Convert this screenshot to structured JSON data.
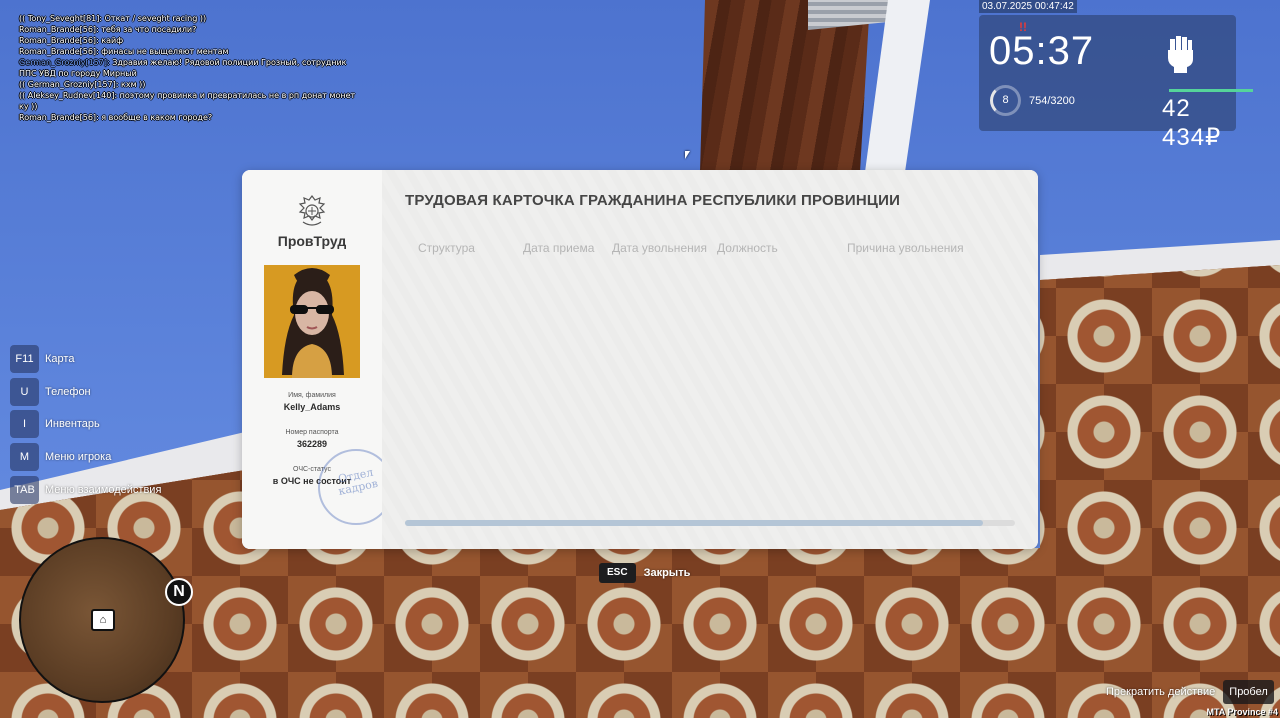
{
  "chat": [
    {
      "text": "(( Tony_Seveght[81]: Откат / seveght racing ))",
      "color": "#ffffff"
    },
    {
      "text": "Roman_Brande[56]: тебя за что посадили?",
      "color": "#ffffff"
    },
    {
      "text": "Roman_Brande[56]: кайф",
      "color": "#ffffff"
    },
    {
      "text": "Roman_Brande[56]: финасы не выщеляют ментам",
      "color": "#ffffff"
    },
    {
      "text_blue": "German_Grozniy[157]:",
      "text": " Здравия желаю! Рядовой полиции Грозный, сотрудник ППС УВД по городу Мирный",
      "color": "#6f9cf5"
    },
    {
      "text": "(( German_Grozniy[157]: кхм ))",
      "color": "#ffffff"
    },
    {
      "text": "(( Aleksey_Rudnev[140]: поэтому провинка и превратилась не в рп донат монет ку ))",
      "color": "#ffffff"
    },
    {
      "text": "Roman_Brande[56]: я вообще в каком городе?",
      "color": "#ffffff"
    }
  ],
  "hud": {
    "datetime": "03.07.2025 00:47:42",
    "clock": "05:37",
    "notification_mark": "!!",
    "level": "8",
    "xp": "754/3200",
    "xp_fraction": 0.236,
    "money": "42 434₽",
    "accent": "#55d49a"
  },
  "keys": [
    {
      "key": "F11",
      "label": "Карта"
    },
    {
      "key": "U",
      "label": "Телефон"
    },
    {
      "key": "I",
      "label": "Инвентарь"
    },
    {
      "key": "M",
      "label": "Меню игрока"
    },
    {
      "key": "TAB",
      "label": "Меню взаимодействия"
    }
  ],
  "minimap": {
    "north": "N",
    "player_icon": "house-icon"
  },
  "card": {
    "org": "ПровТруд",
    "title": "ТРУДОВАЯ КАРТОЧКА ГРАЖДАНИНА РЕСПУБЛИКИ ПРОВИНЦИИ",
    "name_label": "Имя, фамилия",
    "name": "Kelly_Adams",
    "passport_label": "Номер паспорта",
    "passport": "362289",
    "ochs_label": "ОЧС-статус",
    "ochs": "в ОЧС не состоит",
    "stamp_line1": "Отдел",
    "stamp_line2": "кадров",
    "columns": [
      "Структура",
      "Дата приема",
      "Дата увольнения",
      "Должность",
      "Причина увольнения"
    ],
    "rows": [],
    "scroll_fraction": 0.947
  },
  "esc": {
    "key": "ESC",
    "label": "Закрыть"
  },
  "action": {
    "label": "Прекратить действие",
    "key": "Пробел"
  },
  "server": "MTA Province #4"
}
